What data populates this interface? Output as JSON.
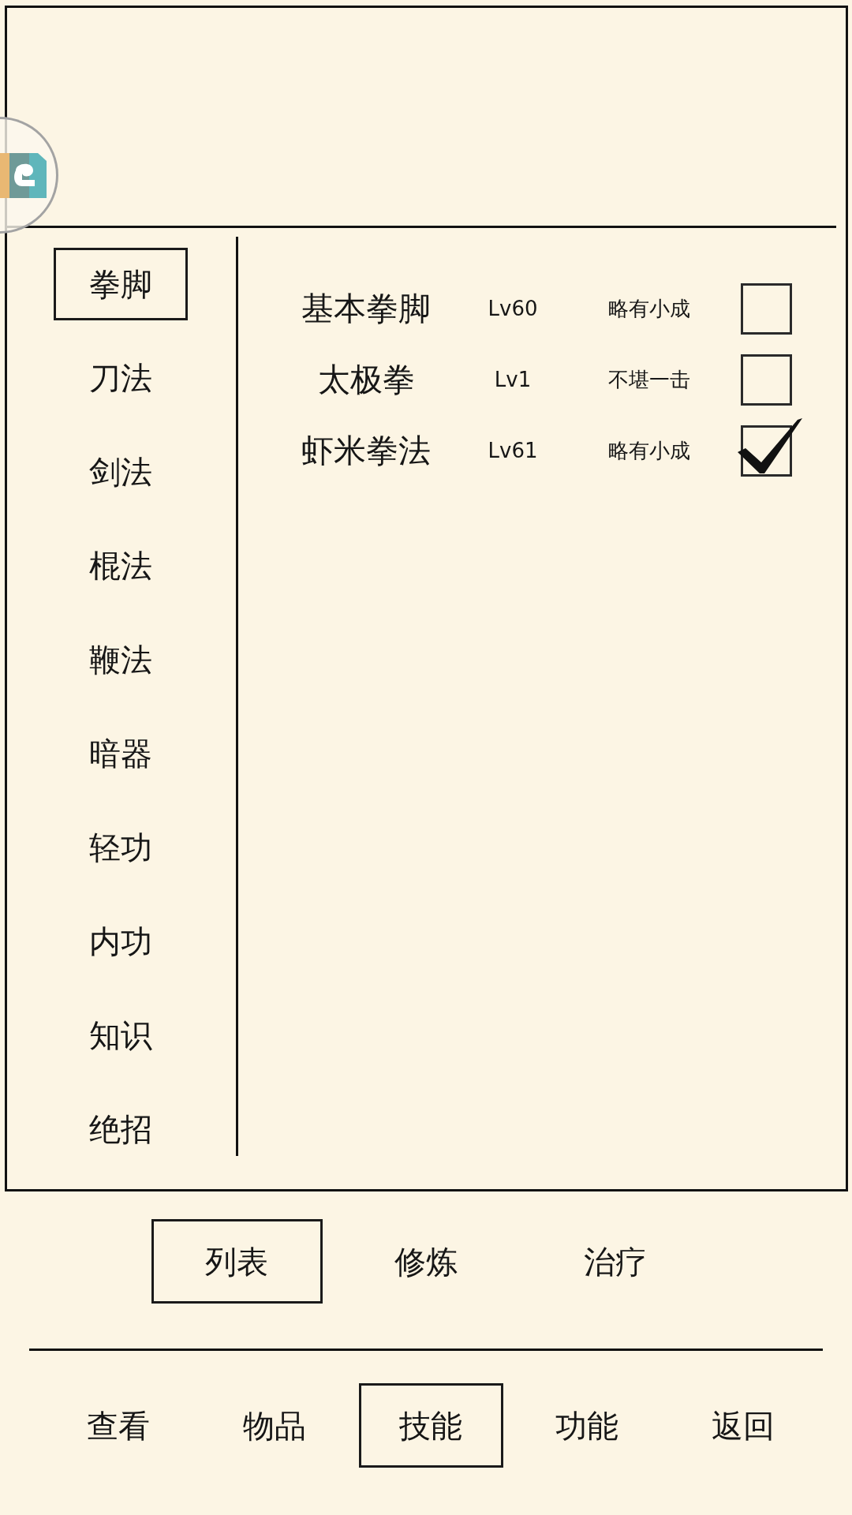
{
  "categories": [
    {
      "label": "拳脚",
      "selected": true
    },
    {
      "label": "刀法",
      "selected": false
    },
    {
      "label": "剑法",
      "selected": false
    },
    {
      "label": "棍法",
      "selected": false
    },
    {
      "label": "鞭法",
      "selected": false
    },
    {
      "label": "暗器",
      "selected": false
    },
    {
      "label": "轻功",
      "selected": false
    },
    {
      "label": "内功",
      "selected": false
    },
    {
      "label": "知识",
      "selected": false
    },
    {
      "label": "绝招",
      "selected": false
    }
  ],
  "skills": [
    {
      "name": "基本拳脚",
      "lv": "Lv60",
      "rank": "略有小成",
      "checked": false
    },
    {
      "name": "太极拳",
      "lv": "Lv1",
      "rank": "不堪一击",
      "checked": false
    },
    {
      "name": "虾米拳法",
      "lv": "Lv61",
      "rank": "略有小成",
      "checked": true
    }
  ],
  "sub_tabs": [
    {
      "label": "列表",
      "selected": true
    },
    {
      "label": "修炼",
      "selected": false
    },
    {
      "label": "治疗",
      "selected": false
    }
  ],
  "nav": [
    {
      "label": "查看",
      "selected": false
    },
    {
      "label": "物品",
      "selected": false
    },
    {
      "label": "技能",
      "selected": true
    },
    {
      "label": "功能",
      "selected": false
    },
    {
      "label": "返回",
      "selected": false
    }
  ]
}
